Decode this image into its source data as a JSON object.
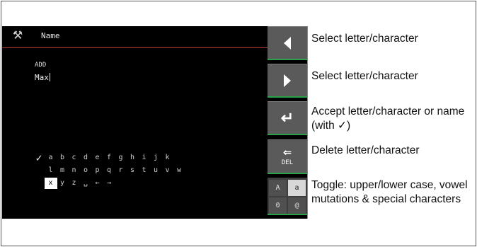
{
  "screen": {
    "title": "Name",
    "field_label": "ADD",
    "field_value": "Max",
    "tools_icon": "tools-icon"
  },
  "keyboard": {
    "row1": [
      "✓",
      "a",
      "b",
      "c",
      "d",
      "e",
      "f",
      "g",
      "h",
      "i",
      "j",
      "k"
    ],
    "row2": [
      "",
      "l",
      "m",
      "n",
      "o",
      "p",
      "q",
      "r",
      "s",
      "t",
      "u",
      "v",
      "w"
    ],
    "row3": [
      "",
      "x",
      "y",
      "z",
      "␣",
      "←",
      "→"
    ],
    "selected": "x"
  },
  "buttons": {
    "del_label": "DEL",
    "mode": [
      "A",
      "a",
      "0",
      "@"
    ],
    "mode_active": "a"
  },
  "descriptions": {
    "select_prev": "Select letter/character",
    "select_next": "Select letter/character",
    "accept": "Accept letter/character or name (with ✓)",
    "delete": "Delete letter/character",
    "toggle": "Toggle: upper/lower case, vowel mutations & special characters"
  },
  "colors": {
    "screen_bg": "#000000",
    "button_bg": "#5a5a5a",
    "accent_green": "#2aa14a",
    "title_rule": "#b23a2c"
  }
}
